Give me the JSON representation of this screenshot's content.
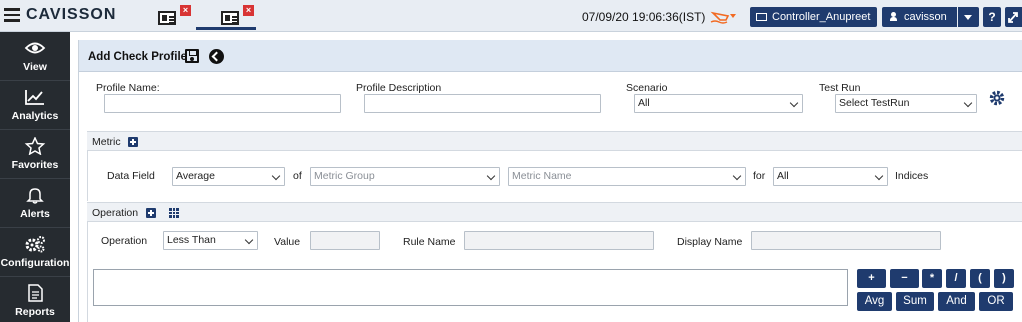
{
  "app": {
    "logo": "CAVISSON",
    "datetime": "07/09/20 19:06:36(IST)",
    "controller_label": "Controller_Anupreet",
    "user_label": "cavisson",
    "help_label": "?"
  },
  "sidebar": {
    "items": [
      {
        "label": "View",
        "icon": "eye-icon"
      },
      {
        "label": "Analytics",
        "icon": "chart-icon"
      },
      {
        "label": "Favorites",
        "icon": "star-icon"
      },
      {
        "label": "Alerts",
        "icon": "bell-icon"
      },
      {
        "label": "Configuration",
        "icon": "gears-icon"
      },
      {
        "label": "Reports",
        "icon": "report-icon"
      }
    ]
  },
  "page": {
    "title": "Add Check Profile"
  },
  "profile": {
    "name_label": "Profile Name:",
    "name_value": "",
    "description_label": "Profile Description",
    "description_value": "",
    "scenario_label": "Scenario",
    "scenario_value": "All",
    "testrun_label": "Test Run",
    "testrun_value": "Select TestRun"
  },
  "metric": {
    "section_label": "Metric",
    "data_field_label": "Data Field",
    "data_field_value": "Average",
    "of_label": "of",
    "metric_group_placeholder": "Metric Group",
    "metric_name_placeholder": "Metric Name",
    "for_label": "for",
    "for_value": "All",
    "indices_label": "Indices"
  },
  "operation": {
    "section_label": "Operation",
    "operation_label": "Operation",
    "operation_value": "Less Than",
    "value_label": "Value",
    "value_value": "",
    "rule_name_label": "Rule Name",
    "rule_name_value": "",
    "display_name_label": "Display Name",
    "display_name_value": ""
  },
  "operators": {
    "row1": [
      "+",
      "−",
      "*",
      "/",
      "(",
      ")"
    ],
    "row2": [
      "Avg",
      "Sum",
      "And",
      "OR"
    ]
  },
  "colors": {
    "primary": "#1f3b6e",
    "sidebar_bg": "#262b30",
    "header_bg": "#dfe8f3",
    "alert_orange": "#f26a21",
    "close_red": "#d83434"
  }
}
